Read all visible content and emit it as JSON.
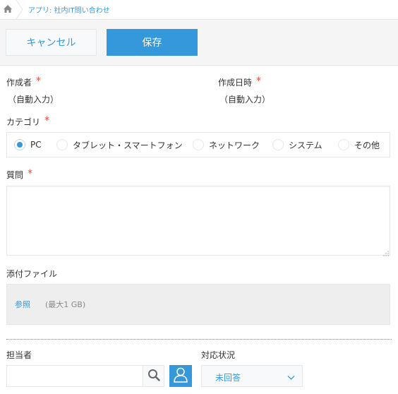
{
  "breadcrumb": {
    "text": "アプリ: 社内IT問い合わせ"
  },
  "toolbar": {
    "cancel_label": "キャンセル",
    "save_label": "保存"
  },
  "fields": {
    "creator": {
      "label": "作成者",
      "required": "*",
      "value": "（自動入力）"
    },
    "created_at": {
      "label": "作成日時",
      "required": "*",
      "value": "（自動入力）"
    },
    "category": {
      "label": "カテゴリ",
      "required": "*",
      "options": [
        "PC",
        "タブレット・スマートフォン",
        "ネットワーク",
        "システム",
        "その他"
      ],
      "selected": "PC"
    },
    "question": {
      "label": "質問",
      "required": "*",
      "value": ""
    },
    "attachment": {
      "label": "添付ファイル",
      "browse_label": "参照",
      "limit_text": "(最大1 GB)"
    },
    "assignee": {
      "label": "担当者",
      "value": ""
    },
    "status": {
      "label": "対応状況",
      "value": "未回答"
    }
  },
  "icons": {
    "home": "home-icon",
    "search": "search-icon",
    "user_picker": "user-icon",
    "dropdown": "chevron-down-icon"
  },
  "colors": {
    "accent": "#3498db",
    "required": "#e74c3c",
    "border": "#e3e7e8",
    "toolbar_bg": "#f5f5f5",
    "attachment_bg": "#eeeeee"
  }
}
